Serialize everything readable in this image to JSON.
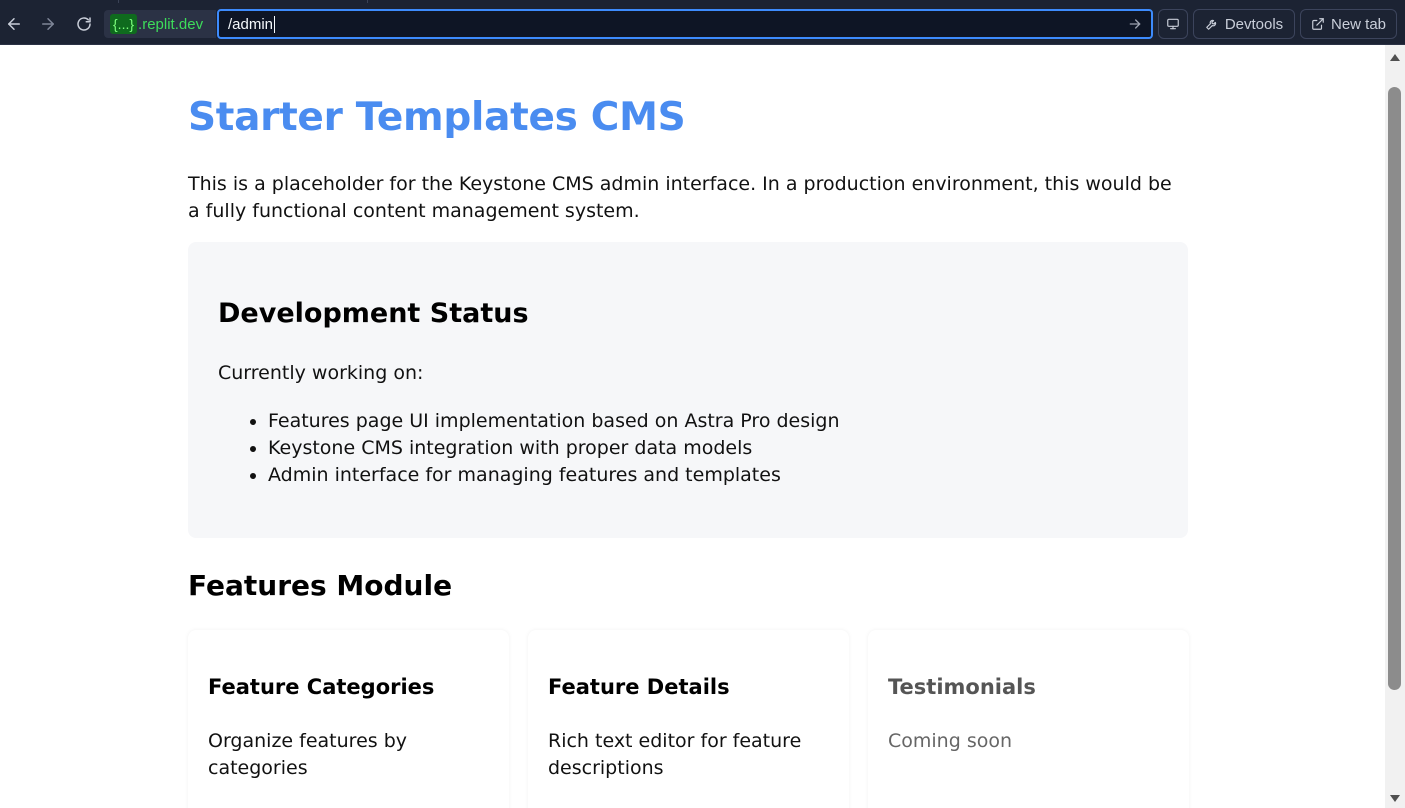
{
  "browser": {
    "origin_badge": "{...}",
    "origin_host": ".replit.dev",
    "url_path": "/admin",
    "devtools_label": "Devtools",
    "new_tab_label": "New tab"
  },
  "page": {
    "title": "Starter Templates CMS",
    "intro": "This is a placeholder for the Keystone CMS admin interface. In a production environment, this would be a fully functional content management system.",
    "status": {
      "heading": "Development Status",
      "subheading": "Currently working on:",
      "items": [
        "Features page UI implementation based on Astra Pro design",
        "Keystone CMS integration with proper data models",
        "Admin interface for managing features and templates"
      ]
    },
    "module": {
      "heading": "Features Module",
      "cards": [
        {
          "title": "Feature Categories",
          "description": "Organize features by categories"
        },
        {
          "title": "Feature Details",
          "description": "Rich text editor for feature descriptions"
        },
        {
          "title": "Testimonials",
          "description": "Coming soon"
        }
      ]
    }
  },
  "colors": {
    "accent_title": "#4a8cf0",
    "browser_bar": "#1c2333",
    "url_focus_border": "#3d8bfd",
    "origin_host_green": "#3ddc5a"
  },
  "icons": [
    "back-arrow-icon",
    "forward-arrow-icon",
    "reload-icon",
    "go-arrow-icon",
    "monitor-icon",
    "wrench-icon",
    "external-link-icon",
    "scroll-up-arrow-icon",
    "scroll-down-arrow-icon"
  ]
}
